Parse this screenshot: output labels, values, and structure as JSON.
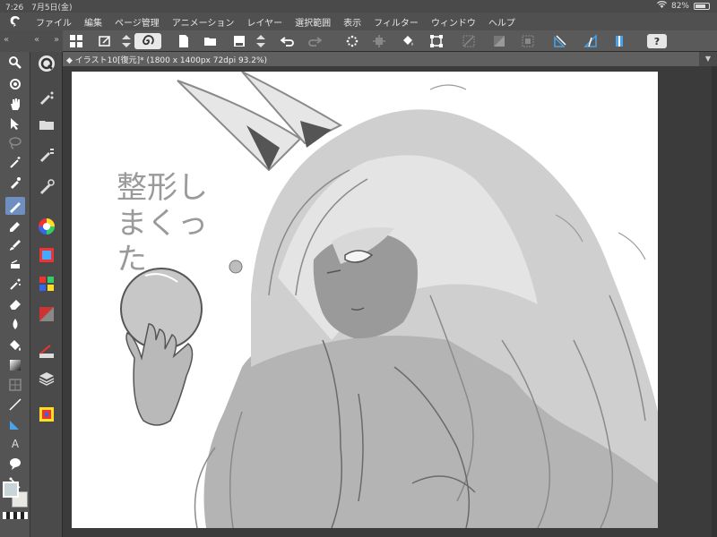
{
  "status": {
    "time": "7:26",
    "date": "7月5日(金)",
    "battery": "82%",
    "battery_level": 0.82
  },
  "menu": {
    "items": [
      "ファイル",
      "編集",
      "ページ管理",
      "アニメーション",
      "レイヤー",
      "選択範囲",
      "表示",
      "フィルター",
      "ウィンドウ",
      "ヘルプ"
    ]
  },
  "commandbar": {
    "help_label": "?",
    "left_controls": [
      "«",
      "«",
      "»"
    ]
  },
  "document": {
    "tab_title": "イラスト10[復元]* (1800 x 1400px 72dpi 93.2%)",
    "tab_close": "◆",
    "panel_toggle": "▼"
  },
  "canvas": {
    "handwritten_note": "整形しまくった"
  },
  "tools": {
    "text_tool_glyph": "A"
  },
  "colors": {
    "accent_selected": "#6e8fbf",
    "main_color": "#c8d4d8",
    "sub_color": "#e8e8e2"
  }
}
